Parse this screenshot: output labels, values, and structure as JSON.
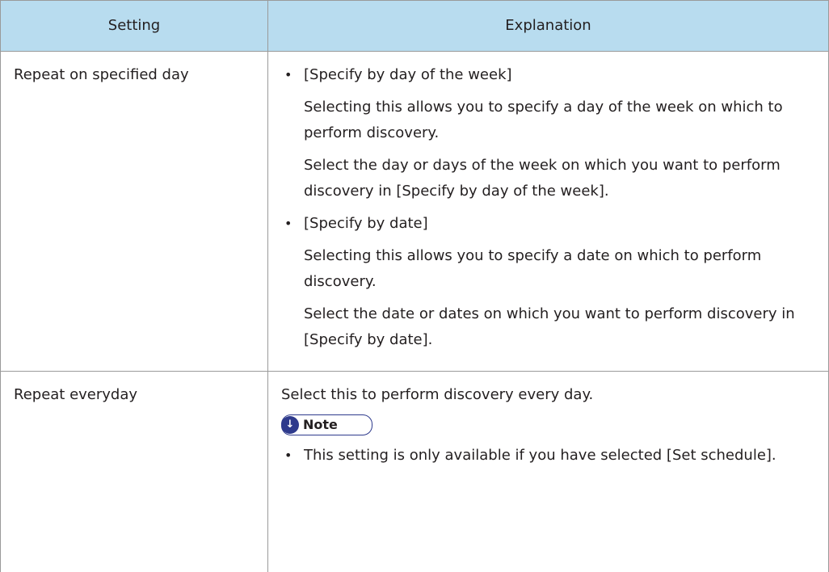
{
  "table": {
    "headers": [
      "Setting",
      "Explanation"
    ],
    "rows": [
      {
        "setting": "Repeat on specified day",
        "items": [
          {
            "bullet": "•",
            "label": "[Specify by day of the week]",
            "paragraphs": [
              "Selecting this allows you to specify a day of the week on which to perform discovery.",
              "Select the day or days of the week on which you want to perform discovery in [Specify by day of the week]."
            ]
          },
          {
            "bullet": "•",
            "label": "[Specify by date]",
            "paragraphs": [
              "Selecting this allows you to specify a date on which to perform discovery.",
              "Select the date or dates on which you want to perform discovery in [Specify by date]."
            ]
          }
        ]
      },
      {
        "setting": "Repeat everyday",
        "text": "Select this to perform discovery every day.",
        "note": {
          "icon": "down-arrow-note-icon",
          "label": "Note",
          "items": [
            {
              "bullet": "•",
              "text": "This setting is only available if you have selected [Set schedule]."
            }
          ]
        }
      }
    ]
  },
  "colors": {
    "header_bg": "#b8dcef",
    "border": "#9a9a9a",
    "note_accent": "#2e3a8c"
  }
}
